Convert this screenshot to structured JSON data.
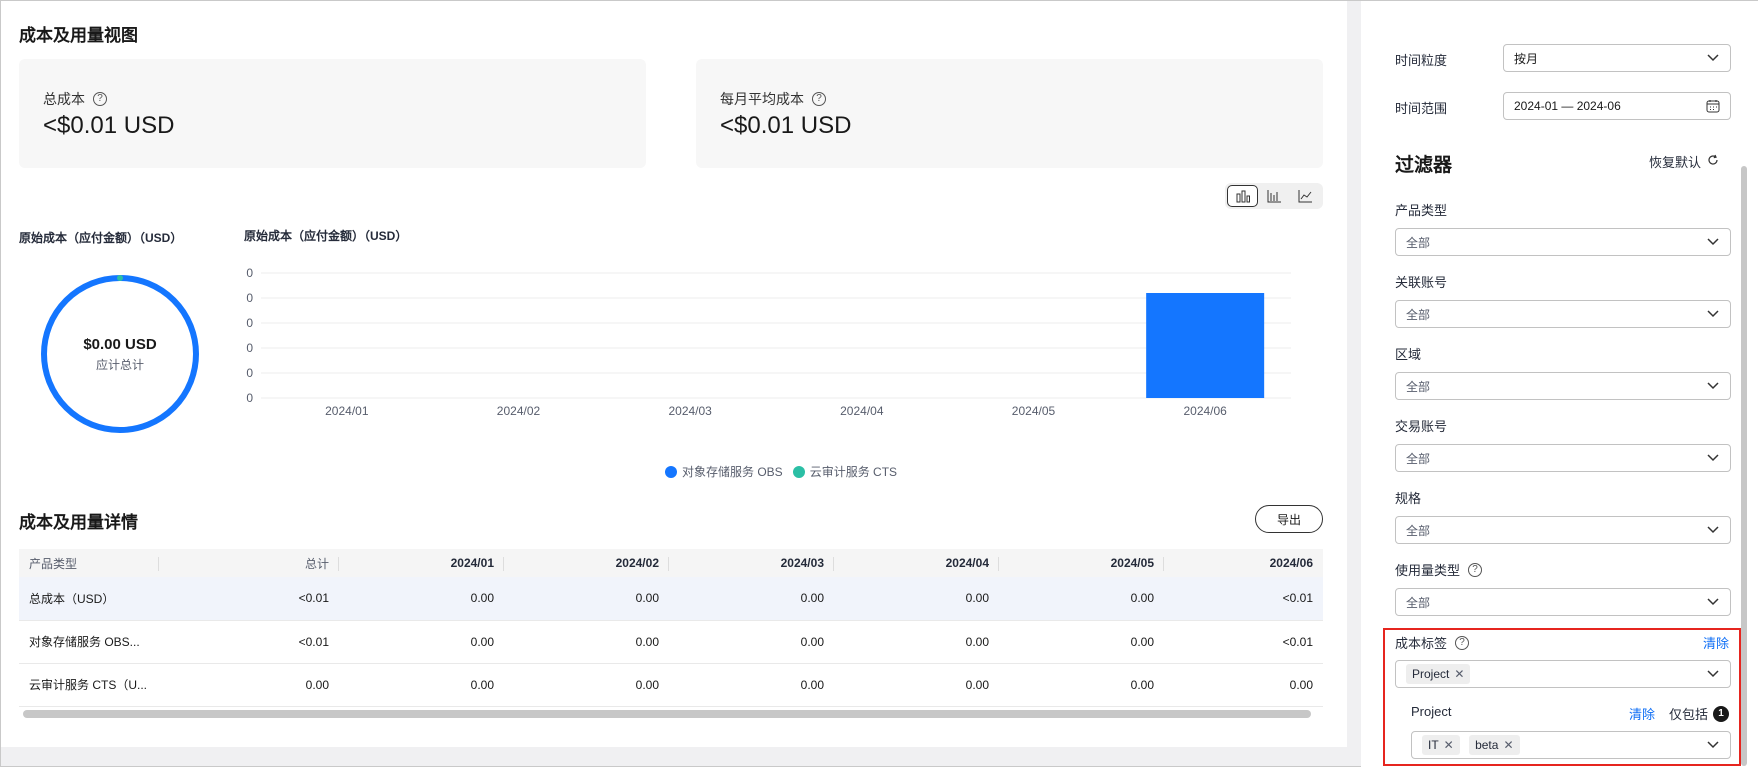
{
  "main": {
    "view_title": "成本及用量视图",
    "cards": [
      {
        "label": "总成本",
        "value": "<$0.01 USD"
      },
      {
        "label": "每月平均成本",
        "value": "<$0.01 USD"
      }
    ],
    "chart_toggle": [
      "bar-chart-icon",
      "column-chart-icon",
      "line-chart-icon"
    ],
    "donut": {
      "title": "原始成本（应付金额）（USD）",
      "value": "$0.00 USD",
      "subtitle": "应计总计",
      "colors": {
        "primary": "#1476ff",
        "secondary": "#2bbfa5"
      }
    },
    "details_title": "成本及用量详情",
    "export_label": "导出",
    "table": {
      "columns": [
        "产品类型",
        "总计",
        "2024/01",
        "2024/02",
        "2024/03",
        "2024/04",
        "2024/05",
        "2024/06"
      ],
      "rows": [
        [
          "总成本（USD）",
          "<0.01",
          "0.00",
          "0.00",
          "0.00",
          "0.00",
          "0.00",
          "<0.01"
        ],
        [
          "对象存储服务 OBS...",
          "<0.01",
          "0.00",
          "0.00",
          "0.00",
          "0.00",
          "0.00",
          "<0.01"
        ],
        [
          "云审计服务 CTS（U...",
          "0.00",
          "0.00",
          "0.00",
          "0.00",
          "0.00",
          "0.00",
          "0.00"
        ]
      ]
    }
  },
  "chart_data": {
    "type": "bar",
    "title": "原始成本（应付金额）（USD）",
    "categories": [
      "2024/01",
      "2024/02",
      "2024/03",
      "2024/04",
      "2024/05",
      "2024/06"
    ],
    "y_ticks": [
      "0",
      "0",
      "0",
      "0",
      "0",
      "0"
    ],
    "series": [
      {
        "name": "对象存储服务 OBS",
        "color": "#1476ff",
        "values": [
          0,
          0,
          0,
          0,
          0,
          0.0042
        ]
      },
      {
        "name": "云审计服务 CTS",
        "color": "#2bbfa5",
        "values": [
          0,
          0,
          0,
          0,
          0,
          0
        ]
      }
    ],
    "ylim": [
      0,
      0.005
    ],
    "grid": true,
    "legend": "bottom"
  },
  "sidebar": {
    "granularity_label": "时间粒度",
    "granularity_value": "按月",
    "range_label": "时间范围",
    "range_value": "2024-01 — 2024-06",
    "filter_title": "过滤器",
    "reset_label": "恢复默认",
    "filters": [
      {
        "label": "产品类型",
        "value": "全部"
      },
      {
        "label": "关联账号",
        "value": "全部"
      },
      {
        "label": "区域",
        "value": "全部"
      },
      {
        "label": "交易账号",
        "value": "全部"
      },
      {
        "label": "规格",
        "value": "全部"
      },
      {
        "label": "使用量类型",
        "value": "全部"
      }
    ],
    "cost_tag": {
      "label": "成本标签",
      "clear": "清除",
      "selected_tag": "Project",
      "sub_label": "Project",
      "sub_clear": "清除",
      "only_include": "仅包括",
      "badge": "1",
      "values": [
        "IT",
        "beta"
      ]
    }
  }
}
